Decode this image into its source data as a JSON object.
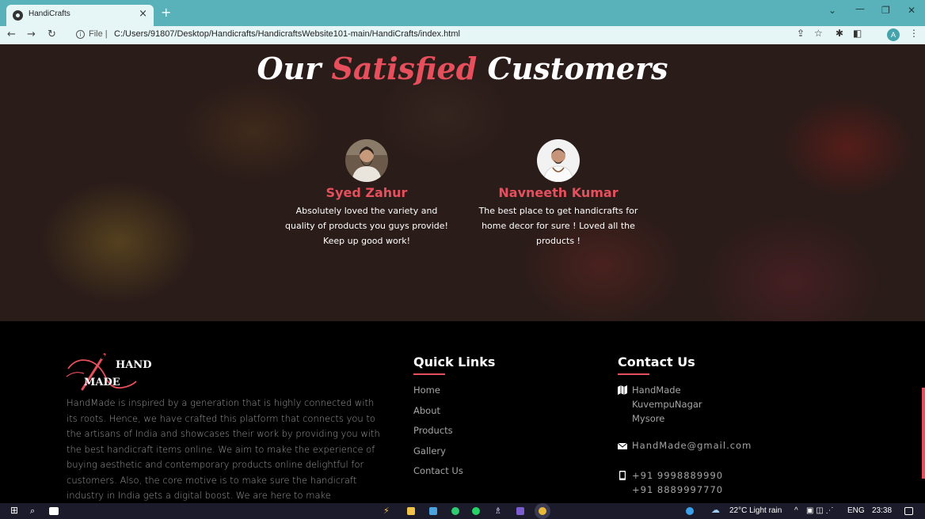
{
  "browser": {
    "tab_title": "HandiCrafts",
    "tab_close": "×",
    "new_tab": "+",
    "url_scheme": "File |",
    "url": "C:/Users/91807/Desktop/Handicrafts/HandicraftsWebsite101-main/HandiCrafts/index.html",
    "profile_initial": "A"
  },
  "testimonials": {
    "title_pre": "Our ",
    "title_accent": "Satisfied",
    "title_post": " Customers",
    "reviews": [
      {
        "name": "Syed Zahur",
        "text": "Absolutely loved the variety and quality of products you guys provide! Keep up good work!"
      },
      {
        "name": "Navneeth Kumar",
        "text": "The best place to get handicrafts for home decor for sure ! Loved all the products !"
      }
    ]
  },
  "footer": {
    "logo_line1": "HAND",
    "logo_line2": "MADE",
    "about": "HandMade is inspired by a generation that is highly connected with its roots. Hence, we have crafted this platform that connects you to the artisans of India and showcases their work by providing you with the best handicraft items online. We aim to make the experience of buying aesthetic and contemporary products online delightful for customers. Also, the core motive is to make sure the handicraft industry in India gets a digital boost. We are here to make purchasing products online convenient for your lifestyle.",
    "quick_links_heading": "Quick Links",
    "quick_links": [
      "Home",
      "About",
      "Products",
      "Gallery",
      "Contact Us"
    ],
    "contact_heading": "Contact Us",
    "address": [
      "HandMade",
      "KuvempuNagar",
      "Mysore"
    ],
    "email": "HandMade@gmail.com",
    "phones": [
      "+91 9998889990",
      "+91 8889997770"
    ]
  },
  "taskbar": {
    "weather": "22°C  Light rain",
    "language": "ENG",
    "time": "23:38"
  },
  "colors": {
    "accent": "#e84f5d",
    "chrome": "#59b2b9",
    "footer_bg": "#000000"
  }
}
